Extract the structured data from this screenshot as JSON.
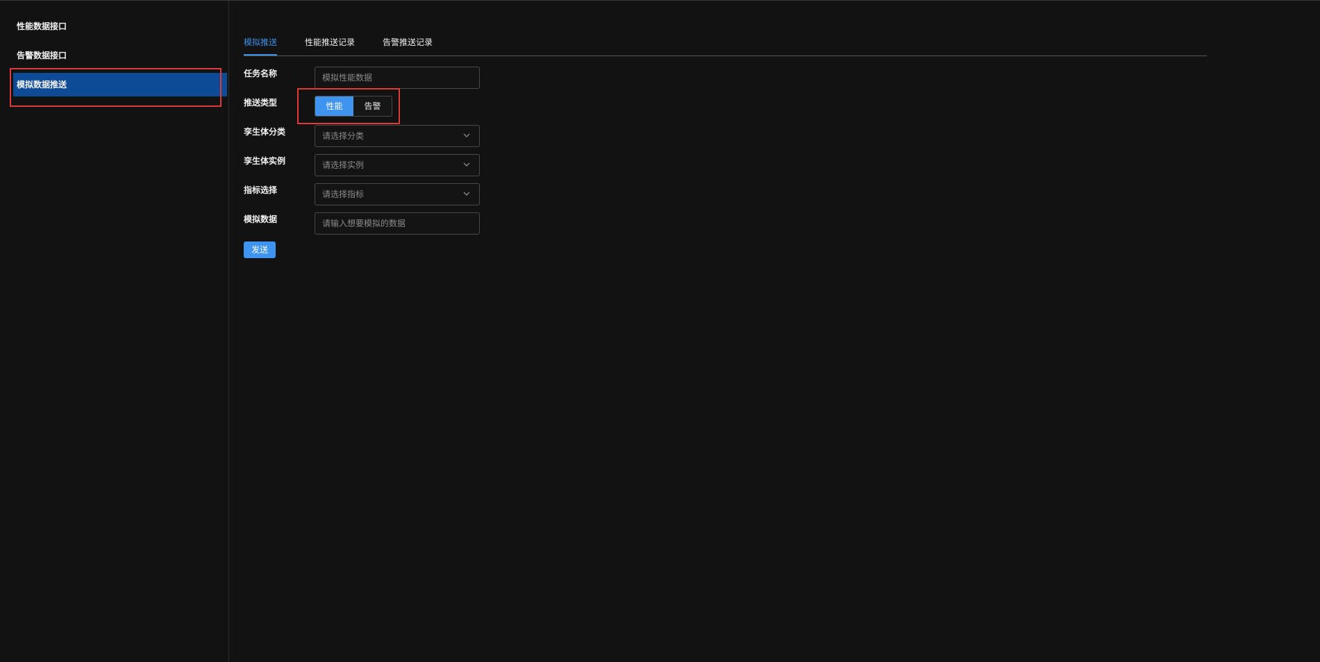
{
  "sidebar": {
    "items": [
      {
        "label": "性能数据接口"
      },
      {
        "label": "告警数据接口"
      },
      {
        "label": "模拟数据推送"
      }
    ]
  },
  "tabs": [
    {
      "label": "模拟推送"
    },
    {
      "label": "性能推送记录"
    },
    {
      "label": "告警推送记录"
    }
  ],
  "form": {
    "task_name": {
      "label": "任务名称",
      "placeholder": "模拟性能数据"
    },
    "push_type": {
      "label": "推送类型",
      "options": [
        "性能",
        "告警"
      ],
      "selected": "性能"
    },
    "twin_category": {
      "label": "孪生体分类",
      "placeholder": "请选择分类"
    },
    "twin_instance": {
      "label": "孪生体实例",
      "placeholder": "请选择实例"
    },
    "metric": {
      "label": "指标选择",
      "placeholder": "请选择指标"
    },
    "mock_data": {
      "label": "模拟数据",
      "placeholder": "请输入想要模拟的数据"
    },
    "send_label": "发送"
  },
  "colors": {
    "accent": "#3f94f0",
    "sidebar_active": "#0e4b96",
    "highlight": "#e03a3a",
    "background": "#121212"
  }
}
